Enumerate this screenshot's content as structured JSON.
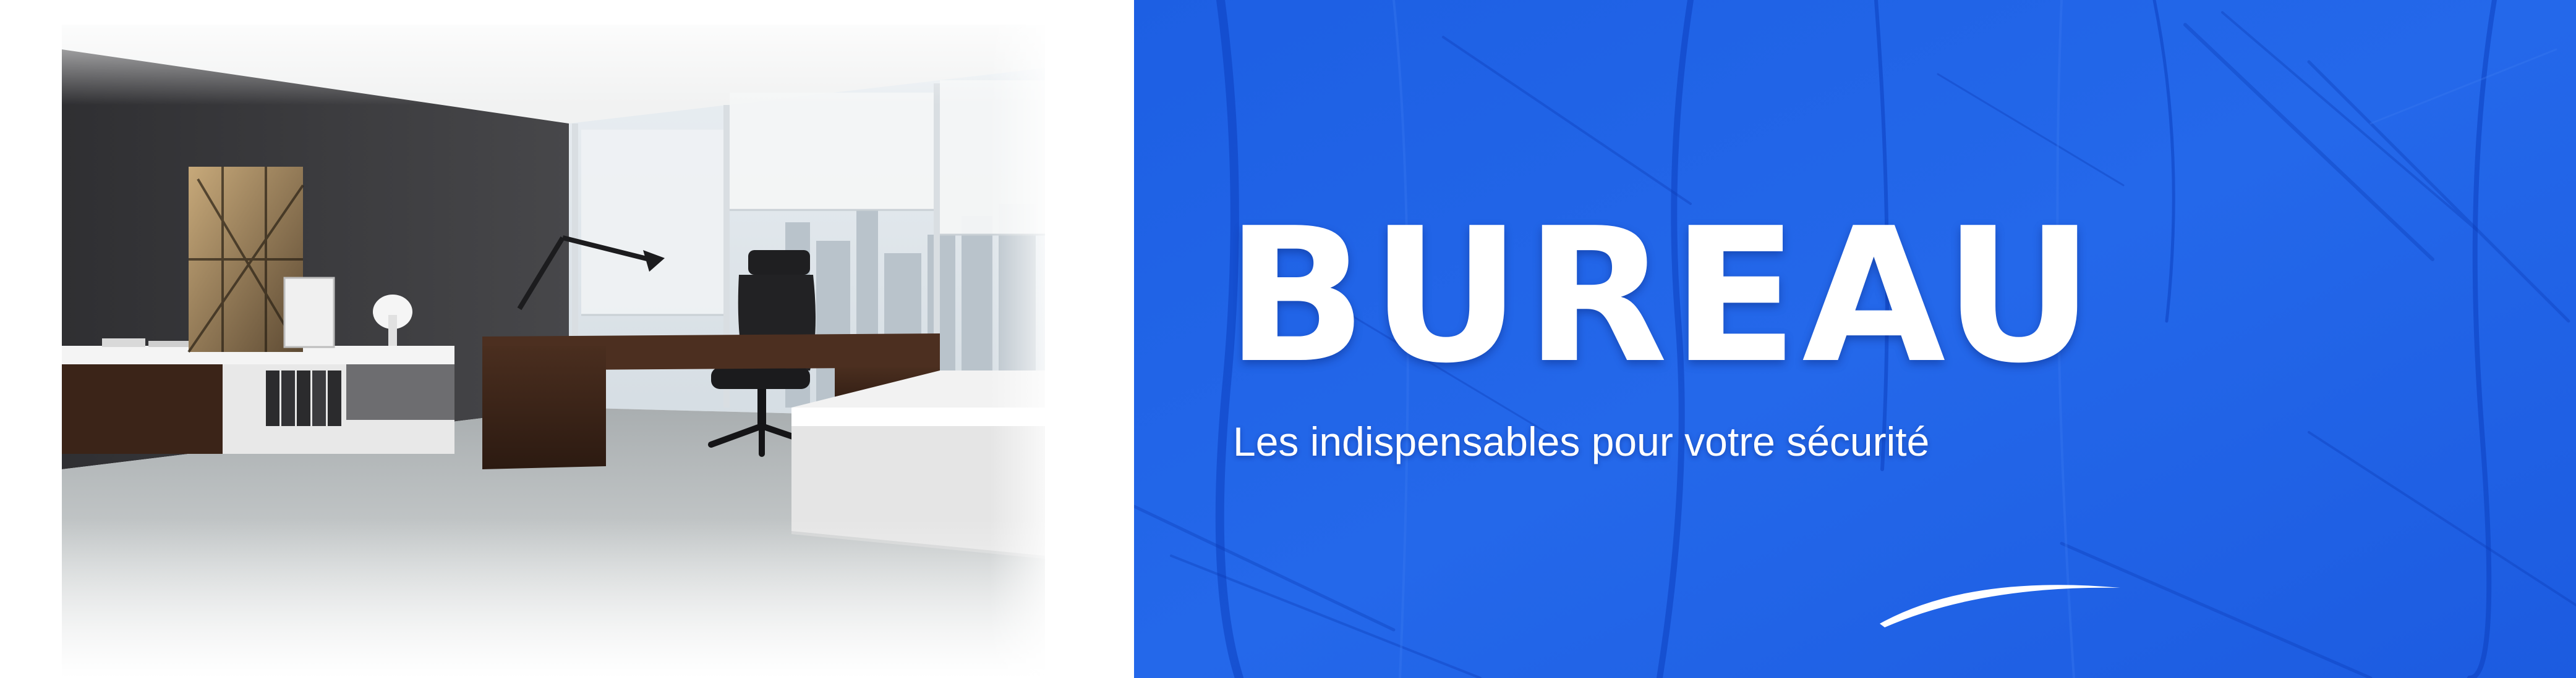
{
  "banner": {
    "headline": "BUREAU",
    "subline": "Les indispensables pour votre sécurité",
    "photo_alt": "Bureau moderne avec fauteuil, bureau en bois et vue sur la ville"
  },
  "colors": {
    "panel_blue": "#1f63e6",
    "panel_blue_dark": "#0f45c8",
    "text": "#ffffff",
    "wall": "#3a3a3d",
    "desk_wood": "#3b2418"
  },
  "icons": {
    "swoosh": "swoosh-icon"
  }
}
